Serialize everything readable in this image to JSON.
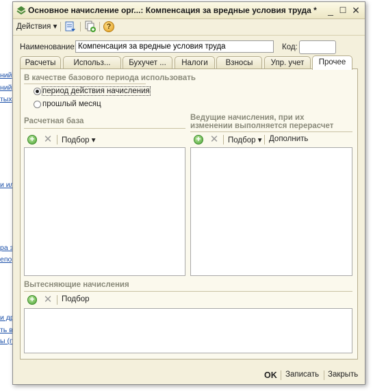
{
  "background_links": [
    "ний",
    "ний",
    "тых",
    "и ил",
    "ра з",
    "епо",
    "и др",
    "ть в",
    "ы (п"
  ],
  "window": {
    "title": "Основное начисление орг...: Компенсация за вредные условия труда *",
    "minimize": "_",
    "maximize": "☐",
    "close": "✕"
  },
  "toolbar": {
    "actions_label": "Действия",
    "actions_arrow": "▾",
    "help_glyph": "?"
  },
  "form": {
    "name_label": "Наименование:",
    "name_value": "Компенсация за вредные условия труда",
    "code_label": "Код:",
    "code_value": ""
  },
  "tabs": [
    {
      "label": "Расчеты"
    },
    {
      "label": "Использ..."
    },
    {
      "label": "Бухучет ..."
    },
    {
      "label": "Налоги"
    },
    {
      "label": "Взносы"
    },
    {
      "label": "Упр. учет"
    },
    {
      "label": "Прочее"
    }
  ],
  "active_tab": "Прочее",
  "base_period": {
    "title": "В качестве базового периода использовать",
    "options": [
      {
        "label": "период действия начисления",
        "selected": true
      },
      {
        "label": "прошлый месяц",
        "selected": false
      }
    ]
  },
  "calc_base": {
    "title": "Расчетная база",
    "select_label": "Подбор",
    "arrow": "▾",
    "items": []
  },
  "leading": {
    "title_line1": "Ведущие начисления, при их",
    "title_line2": "изменении выполняется перерасчет",
    "select_label": "Подбор",
    "arrow": "▾",
    "fill_label": "Дополнить",
    "items": []
  },
  "displacing": {
    "title": "Вытесняющие начисления",
    "select_label": "Подбор",
    "items": []
  },
  "footer": {
    "ok": "OK",
    "save": "Записать",
    "close": "Закрыть"
  }
}
